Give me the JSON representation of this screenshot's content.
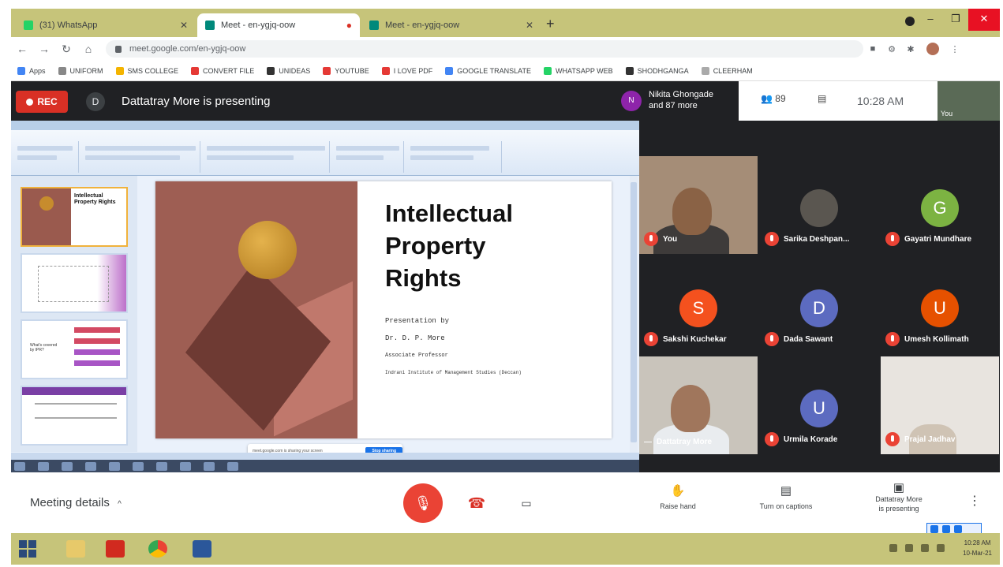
{
  "browser": {
    "tabs": [
      {
        "title": "(31) WhatsApp",
        "color": "#25d366",
        "active": false
      },
      {
        "title": "Meet - en-ygjq-oow",
        "color": "#00897b",
        "active": true
      },
      {
        "title": "Meet - en-ygjq-oow",
        "color": "#00897b",
        "active": false
      }
    ],
    "url": "meet.google.com/en-ygjq-oow",
    "bookmarks": [
      {
        "label": "Apps",
        "color": "#4285f4"
      },
      {
        "label": "UNIFORM",
        "color": "#888888"
      },
      {
        "label": "SMS COLLEGE",
        "color": "#f4b400"
      },
      {
        "label": "CONVERT FILE",
        "color": "#e53935"
      },
      {
        "label": "UNIDEAS",
        "color": "#333333"
      },
      {
        "label": "YOUTUBE",
        "color": "#e53935"
      },
      {
        "label": "I LOVE PDF",
        "color": "#e53935"
      },
      {
        "label": "GOOGLE TRANSLATE",
        "color": "#4285f4"
      },
      {
        "label": "WHATSAPP WEB",
        "color": "#25d366"
      },
      {
        "label": "SHODHGANGA",
        "color": "#333333"
      },
      {
        "label": "CLEERHAM",
        "color": "#aaaaaa"
      }
    ]
  },
  "meet": {
    "rec_label": "REC",
    "presenter_initial": "D",
    "presenting_text": "Dattatray More is presenting",
    "people_initial": "N",
    "people_line1": "Nikita Ghongade",
    "people_line2": "and 87 more",
    "people_count": "89",
    "time": "10:28 AM",
    "self_label": "You"
  },
  "slide": {
    "title_line1": "Intellectual",
    "title_line2": "Property",
    "title_line3": "Rights",
    "sub_line1": "Presentation by",
    "sub_line2": "Dr. D. P. More",
    "sub_line3": "Associate Professor",
    "sub_line4": "Indrani Institute of Management Studies (Deccan)",
    "thumb1_title": "Intellectual Property Rights",
    "thumb3_text": "What's covered by IPR?",
    "share_pill_text": "meet.google.com is sharing your screen",
    "share_pill_button": "Stop sharing"
  },
  "participants": [
    {
      "name": "You",
      "type": "camera"
    },
    {
      "name": "Sarika Deshpan...",
      "type": "photo"
    },
    {
      "name": "Gayatri Mundhare",
      "type": "avatar",
      "initial": "G",
      "color": "#7cb342"
    },
    {
      "name": "Sakshi Kuchekar",
      "type": "avatar",
      "initial": "S",
      "color": "#f4511e"
    },
    {
      "name": "Dada Sawant",
      "type": "avatar",
      "initial": "D",
      "color": "#5c6bc0"
    },
    {
      "name": "Umesh Kollimath",
      "type": "avatar",
      "initial": "U",
      "color": "#e65100"
    },
    {
      "name": "Dattatray More",
      "type": "camera"
    },
    {
      "name": "Urmila Korade",
      "type": "avatar",
      "initial": "U",
      "color": "#5c6bc0"
    },
    {
      "name": "Prajal Jadhav",
      "type": "camera"
    }
  ],
  "bottombar": {
    "meeting_details": "Meeting details",
    "raise_hand": "Raise hand",
    "captions": "Turn on captions",
    "presenting_line1": "Dattatray More",
    "presenting_line2": "is presenting"
  },
  "taskbar": {
    "time": "10:28 AM",
    "date": "10-Mar-21"
  }
}
